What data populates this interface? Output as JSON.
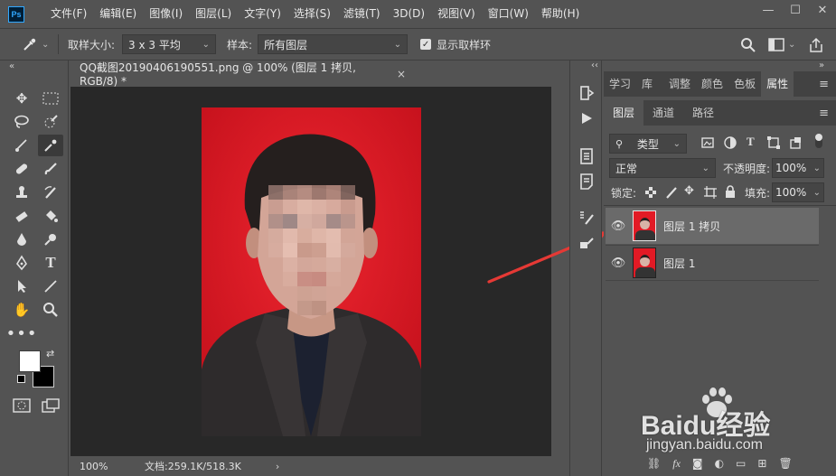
{
  "app": {
    "logo": "Ps",
    "menu": [
      "文件(F)",
      "编辑(E)",
      "图像(I)",
      "图层(L)",
      "文字(Y)",
      "选择(S)",
      "滤镜(T)",
      "3D(D)",
      "视图(V)",
      "窗口(W)",
      "帮助(H)"
    ],
    "window_controls": [
      "—",
      "☐",
      "✕"
    ]
  },
  "options_bar": {
    "sample_size_label": "取样大小:",
    "sample_size_value": "3 x 3 平均",
    "sample_label": "样本:",
    "sample_value": "所有图层",
    "show_ring_label": "显示取样环",
    "show_ring_checked": true
  },
  "document": {
    "tab_title": "QQ截图20190406190551.png @ 100% (图层 1 拷贝, RGB/8) *",
    "close": "×",
    "zoom": "100%",
    "doc_info": "文档:259.1K/518.3K",
    "status_arrow": "›"
  },
  "panels": {
    "top_tabs": [
      "学习",
      "库",
      "调整",
      "颜色",
      "色板",
      "属性"
    ],
    "top_active": "属性",
    "layer_tabs": [
      "图层",
      "通道",
      "路径"
    ],
    "layer_active": "图层",
    "filter_kind": "类型",
    "blend_mode": "正常",
    "opacity_label": "不透明度:",
    "opacity_value": "100%",
    "lock_label": "锁定:",
    "fill_label": "填充:",
    "fill_value": "100%",
    "layers": [
      {
        "name": "图层 1 拷贝",
        "visible": true,
        "selected": true
      },
      {
        "name": "图层 1",
        "visible": true,
        "selected": false
      }
    ]
  },
  "colors": {
    "accent_blue": "#31a8ff",
    "photo_bg_red": "#e21a25",
    "annotation_arrow": "#e53935"
  },
  "watermark": {
    "text": "Baidu经验",
    "url": "jingyan.baidu.com"
  }
}
